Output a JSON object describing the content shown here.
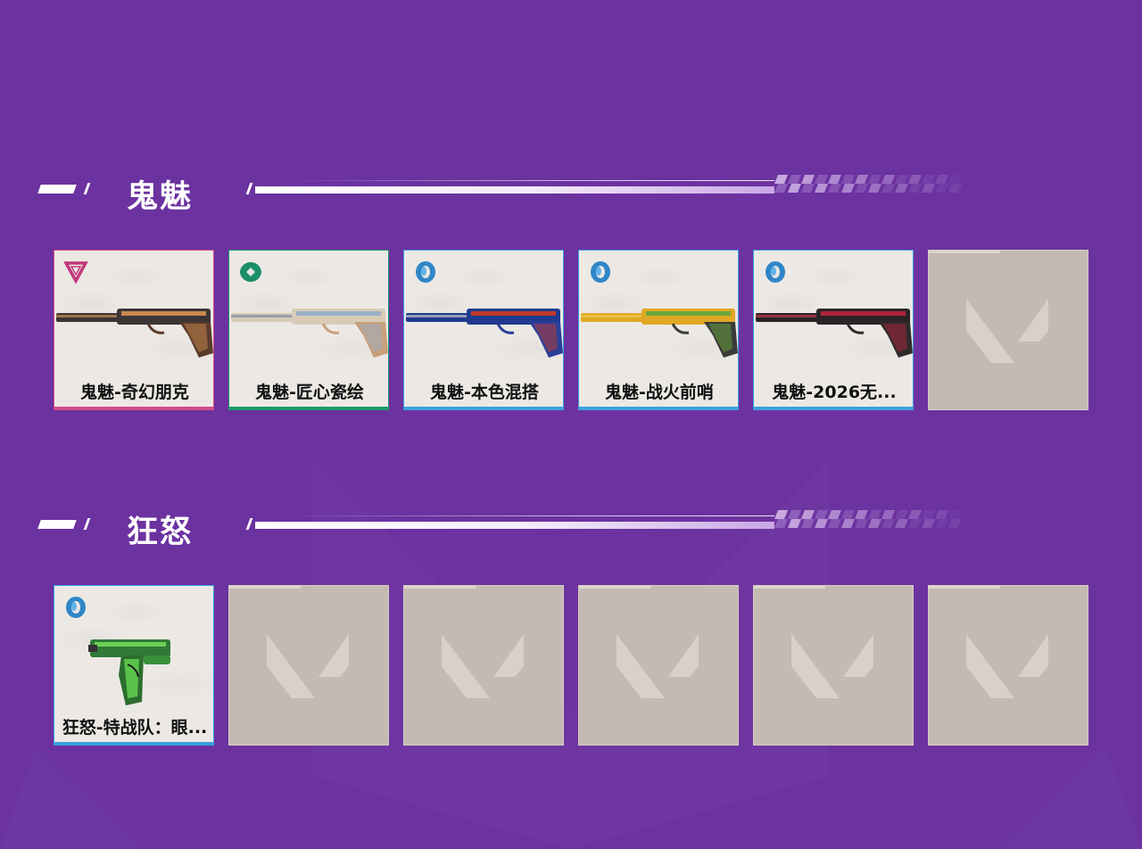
{
  "sections": [
    {
      "title": "鬼魅",
      "items": [
        {
          "name": "鬼魅-奇幻朋克",
          "tier": "pink",
          "icon": "exclusive-tier-icon",
          "gun": "ghost-pistol-copper"
        },
        {
          "name": "鬼魅-匠心瓷绘",
          "tier": "green",
          "icon": "select-tier-icon",
          "gun": "ghost-pistol-porcelain"
        },
        {
          "name": "鬼魅-本色混搭",
          "tier": "blue",
          "icon": "deluxe-tier-icon",
          "gun": "ghost-pistol-blue"
        },
        {
          "name": "鬼魅-战火前哨",
          "tier": "blue",
          "icon": "deluxe-tier-icon",
          "gun": "ghost-pistol-yellow"
        },
        {
          "name": "鬼魅-2026无...",
          "tier": "blue",
          "icon": "deluxe-tier-icon",
          "gun": "ghost-pistol-black-red"
        },
        {
          "empty": true
        }
      ]
    },
    {
      "title": "狂怒",
      "items": [
        {
          "name": "狂怒-特战队：眼...",
          "tier": "blue",
          "icon": "deluxe-tier-icon",
          "gun": "frenzy-pistol-green"
        },
        {
          "empty": true
        },
        {
          "empty": true
        },
        {
          "empty": true
        },
        {
          "empty": true
        },
        {
          "empty": true
        }
      ]
    }
  ],
  "colors": {
    "background": "#6c32a0",
    "tier_pink": "#d44a8a",
    "tier_green": "#1a9a6e",
    "tier_blue": "#3aa0e0",
    "empty_slot": "#c4bab2"
  }
}
